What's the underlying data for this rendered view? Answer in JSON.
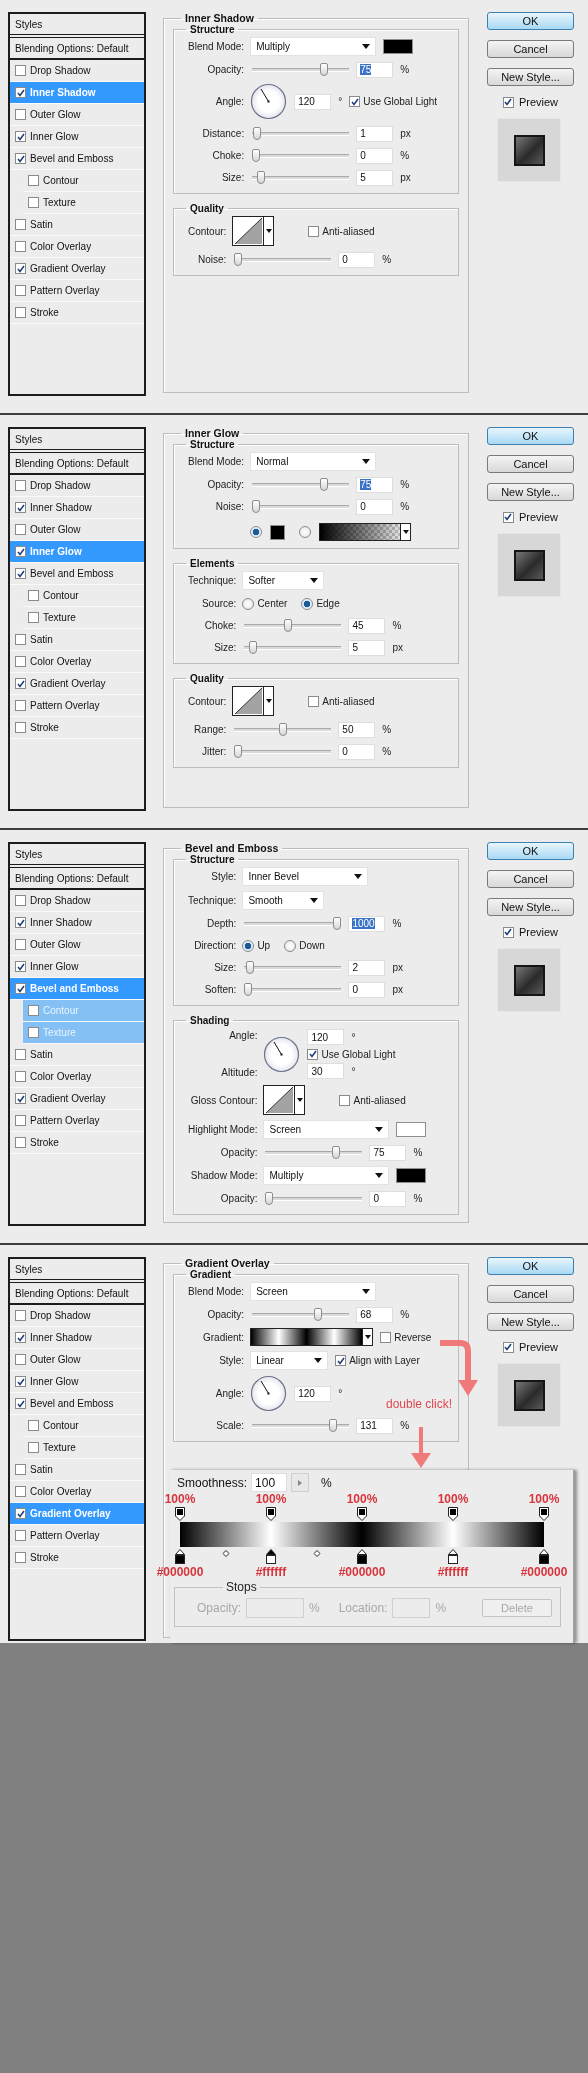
{
  "panels": [
    {
      "styles": {
        "title": "Styles",
        "blending": "Blending Options: Default",
        "items": [
          {
            "label": "Drop Shadow",
            "checked": false,
            "selected": false
          },
          {
            "label": "Inner Shadow",
            "checked": true,
            "selected": true
          },
          {
            "label": "Outer Glow",
            "checked": false,
            "selected": false
          },
          {
            "label": "Inner Glow",
            "checked": true,
            "selected": false
          },
          {
            "label": "Bevel and Emboss",
            "checked": true,
            "selected": false,
            "children": [
              {
                "label": "Contour",
                "checked": false,
                "highlighted": false
              },
              {
                "label": "Texture",
                "checked": false,
                "highlighted": false
              }
            ]
          },
          {
            "label": "Satin",
            "checked": false,
            "selected": false
          },
          {
            "label": "Color Overlay",
            "checked": false,
            "selected": false
          },
          {
            "label": "Gradient Overlay",
            "checked": true,
            "selected": false
          },
          {
            "label": "Pattern Overlay",
            "checked": false,
            "selected": false
          },
          {
            "label": "Stroke",
            "checked": false,
            "selected": false
          }
        ]
      },
      "title": "Inner Shadow",
      "groups": [
        {
          "title": "Structure",
          "rows": [
            {
              "kind": "dropdown",
              "label": "Blend Mode:",
              "value": "Multiply",
              "color": "#000000"
            },
            {
              "kind": "slider",
              "label": "Opacity:",
              "level": 0.76,
              "value": "75",
              "unit": "%",
              "focused": true
            },
            {
              "kind": "angle",
              "label": "Angle:",
              "value": "120",
              "unit": "°",
              "checkbox": {
                "label": "Use Global Light",
                "checked": true
              }
            },
            {
              "kind": "slider",
              "label": "Distance:",
              "level": 0.01,
              "value": "1",
              "unit": "px",
              "focused": false
            },
            {
              "kind": "slider",
              "label": "Choke:",
              "level": 0,
              "value": "0",
              "unit": "%",
              "focused": false
            },
            {
              "kind": "slider",
              "label": "Size:",
              "level": 0.05,
              "value": "5",
              "unit": "px",
              "focused": false
            }
          ]
        },
        {
          "title": "Quality",
          "rows": [
            {
              "kind": "contour",
              "label": "Contour:",
              "checkbox": {
                "label": "Anti-aliased",
                "checked": false
              }
            },
            {
              "kind": "slider",
              "label": "Noise:",
              "level": 0,
              "value": "0",
              "unit": "%",
              "focused": false
            }
          ]
        }
      ],
      "buttons": [
        {
          "label": "OK",
          "default": true
        },
        {
          "label": "Cancel",
          "default": false
        },
        {
          "label": "New Style...",
          "default": false
        }
      ],
      "preview": {
        "label": "Preview",
        "checked": true
      }
    },
    {
      "styles": {
        "title": "Styles",
        "blending": "Blending Options: Default",
        "items": [
          {
            "label": "Drop Shadow",
            "checked": false,
            "selected": false
          },
          {
            "label": "Inner Shadow",
            "checked": true,
            "selected": false
          },
          {
            "label": "Outer Glow",
            "checked": false,
            "selected": false
          },
          {
            "label": "Inner Glow",
            "checked": true,
            "selected": true
          },
          {
            "label": "Bevel and Emboss",
            "checked": true,
            "selected": false,
            "children": [
              {
                "label": "Contour",
                "checked": false,
                "highlighted": false
              },
              {
                "label": "Texture",
                "checked": false,
                "highlighted": false
              }
            ]
          },
          {
            "label": "Satin",
            "checked": false,
            "selected": false
          },
          {
            "label": "Color Overlay",
            "checked": false,
            "selected": false
          },
          {
            "label": "Gradient Overlay",
            "checked": true,
            "selected": false
          },
          {
            "label": "Pattern Overlay",
            "checked": false,
            "selected": false
          },
          {
            "label": "Stroke",
            "checked": false,
            "selected": false
          }
        ]
      },
      "title": "Inner Glow",
      "groups": [
        {
          "title": "Structure",
          "rows": [
            {
              "kind": "dropdown",
              "label": "Blend Mode:",
              "value": "Normal"
            },
            {
              "kind": "slider",
              "label": "Opacity:",
              "level": 0.76,
              "value": "75",
              "unit": "%",
              "focused": true
            },
            {
              "kind": "slider",
              "label": "Noise:",
              "level": 0,
              "value": "0",
              "unit": "%",
              "focused": false
            },
            {
              "kind": "fill_choice",
              "options": [
                {
                  "kind": "color",
                  "selected": true,
                  "color": "#000000"
                },
                {
                  "kind": "gradient",
                  "selected": false
                }
              ]
            }
          ]
        },
        {
          "title": "Elements",
          "rows": [
            {
              "kind": "small_dropdown",
              "label": "Technique:",
              "value": "Softer"
            },
            {
              "kind": "radio",
              "label": "Source:",
              "options": [
                {
                  "label": "Center",
                  "selected": false
                },
                {
                  "label": "Edge",
                  "selected": true
                }
              ]
            },
            {
              "kind": "slider",
              "label": "Choke:",
              "level": 0.45,
              "value": "45",
              "unit": "%",
              "focused": false
            },
            {
              "kind": "slider",
              "label": "Size:",
              "level": 0.05,
              "value": "5",
              "unit": "px",
              "focused": false
            }
          ]
        },
        {
          "title": "Quality",
          "rows": [
            {
              "kind": "contour",
              "label": "Contour:",
              "checkbox": {
                "label": "Anti-aliased",
                "checked": false
              }
            },
            {
              "kind": "slider",
              "label": "Range:",
              "level": 0.5,
              "value": "50",
              "unit": "%",
              "focused": false
            },
            {
              "kind": "slider",
              "label": "Jitter:",
              "level": 0,
              "value": "0",
              "unit": "%",
              "focused": false
            }
          ]
        }
      ],
      "buttons": [
        {
          "label": "OK",
          "default": true
        },
        {
          "label": "Cancel",
          "default": false
        },
        {
          "label": "New Style...",
          "default": false
        }
      ],
      "preview": {
        "label": "Preview",
        "checked": true
      }
    },
    {
      "styles": {
        "title": "Styles",
        "blending": "Blending Options: Default",
        "items": [
          {
            "label": "Drop Shadow",
            "checked": false,
            "selected": false
          },
          {
            "label": "Inner Shadow",
            "checked": true,
            "selected": false
          },
          {
            "label": "Outer Glow",
            "checked": false,
            "selected": false
          },
          {
            "label": "Inner Glow",
            "checked": true,
            "selected": false
          },
          {
            "label": "Bevel and Emboss",
            "checked": true,
            "selected": true,
            "children": [
              {
                "label": "Contour",
                "checked": false,
                "highlighted": true
              },
              {
                "label": "Texture",
                "checked": false,
                "highlighted": true
              }
            ]
          },
          {
            "label": "Satin",
            "checked": false,
            "selected": false
          },
          {
            "label": "Color Overlay",
            "checked": false,
            "selected": false
          },
          {
            "label": "Gradient Overlay",
            "checked": true,
            "selected": false
          },
          {
            "label": "Pattern Overlay",
            "checked": false,
            "selected": false
          },
          {
            "label": "Stroke",
            "checked": false,
            "selected": false
          }
        ]
      },
      "title": "Bevel and Emboss",
      "groups": [
        {
          "title": "Structure",
          "rows": [
            {
              "kind": "dropdown",
              "label": "Style:",
              "value": "Inner Bevel"
            },
            {
              "kind": "small_dropdown",
              "label": "Technique:",
              "value": "Smooth"
            },
            {
              "kind": "slider",
              "label": "Depth:",
              "level": 1,
              "value": "1000",
              "unit": "%",
              "focused": true
            },
            {
              "kind": "radio",
              "label": "Direction:",
              "options": [
                {
                  "label": "Up",
                  "selected": true
                },
                {
                  "label": "Down",
                  "selected": false
                }
              ]
            },
            {
              "kind": "slider",
              "label": "Size:",
              "level": 0.02,
              "value": "2",
              "unit": "px",
              "focused": false
            },
            {
              "kind": "slider",
              "label": "Soften:",
              "level": 0,
              "value": "0",
              "unit": "px",
              "focused": false
            }
          ]
        },
        {
          "title": "Shading",
          "rows": [
            {
              "kind": "shading_angle",
              "label": "Angle:",
              "value": "120",
              "unit": "°",
              "checkbox": {
                "label": "Use Global Light",
                "checked": true
              },
              "altitude_label": "Altitude:",
              "altitude_value": "30",
              "altitude_unit": "°"
            },
            {
              "kind": "contour",
              "label": "Gloss Contour:",
              "checkbox": {
                "label": "Anti-aliased",
                "checked": false
              }
            },
            {
              "kind": "dropdown",
              "label": "Highlight Mode:",
              "value": "Screen",
              "color": "#ffffff"
            },
            {
              "kind": "slider",
              "label": "Opacity:",
              "level": 0.75,
              "value": "75",
              "unit": "%",
              "focused": false
            },
            {
              "kind": "dropdown",
              "label": "Shadow Mode:",
              "value": "Multiply",
              "color": "#000000"
            },
            {
              "kind": "slider",
              "label": "Opacity:",
              "level": 0,
              "value": "0",
              "unit": "%",
              "focused": false
            }
          ]
        }
      ],
      "buttons": [
        {
          "label": "OK",
          "default": true
        },
        {
          "label": "Cancel",
          "default": false
        },
        {
          "label": "New Style...",
          "default": false
        }
      ],
      "preview": {
        "label": "Preview",
        "checked": true
      }
    },
    {
      "styles": {
        "title": "Styles",
        "blending": "Blending Options: Default",
        "items": [
          {
            "label": "Drop Shadow",
            "checked": false,
            "selected": false
          },
          {
            "label": "Inner Shadow",
            "checked": true,
            "selected": false
          },
          {
            "label": "Outer Glow",
            "checked": false,
            "selected": false
          },
          {
            "label": "Inner Glow",
            "checked": true,
            "selected": false
          },
          {
            "label": "Bevel and Emboss",
            "checked": true,
            "selected": false,
            "children": [
              {
                "label": "Contour",
                "checked": false,
                "highlighted": false
              },
              {
                "label": "Texture",
                "checked": false,
                "highlighted": false
              }
            ]
          },
          {
            "label": "Satin",
            "checked": false,
            "selected": false
          },
          {
            "label": "Color Overlay",
            "checked": false,
            "selected": false
          },
          {
            "label": "Gradient Overlay",
            "checked": true,
            "selected": true
          },
          {
            "label": "Pattern Overlay",
            "checked": false,
            "selected": false
          },
          {
            "label": "Stroke",
            "checked": false,
            "selected": false
          }
        ]
      },
      "title": "Gradient Overlay",
      "groups": [
        {
          "title": "Gradient",
          "rows": [
            {
              "kind": "dropdown",
              "label": "Blend Mode:",
              "value": "Screen"
            },
            {
              "kind": "slider",
              "label": "Opacity:",
              "level": 0.69,
              "value": "68",
              "unit": "%",
              "focused": false
            },
            {
              "kind": "gradient",
              "label": "Gradient:",
              "checkbox": {
                "label": "Reverse",
                "checked": false
              }
            },
            {
              "kind": "small_dropdown",
              "label": "Style:",
              "value": "Linear",
              "checkbox": {
                "label": "Align with Layer",
                "checked": true
              }
            },
            {
              "kind": "angle",
              "label": "Angle:",
              "value": "120",
              "unit": "°"
            },
            {
              "kind": "slider",
              "label": "Scale:",
              "level": 0.86,
              "value": "131",
              "unit": "%",
              "focused": false
            }
          ]
        }
      ],
      "buttons": [
        {
          "label": "OK",
          "default": true
        },
        {
          "label": "Cancel",
          "default": false
        },
        {
          "label": "New Style...",
          "default": false
        }
      ],
      "preview": {
        "label": "Preview",
        "checked": true
      },
      "annotation": "double click!",
      "gradient_editor": {
        "smoothness_label": "Smoothness:",
        "smoothness_value": "100",
        "smoothness_unit": "%",
        "stops": [
          {
            "opacity_label": "100%",
            "color_label": "#000000",
            "color": "#000000",
            "selected": false
          },
          {
            "opacity_label": "100%",
            "color_label": "#ffffff",
            "color": "#ffffff",
            "selected": true
          },
          {
            "opacity_label": "100%",
            "color_label": "#000000",
            "color": "#000000",
            "selected": false
          },
          {
            "opacity_label": "100%",
            "color_label": "#ffffff",
            "color": "#ffffff",
            "selected": false
          },
          {
            "opacity_label": "100%",
            "color_label": "#000000",
            "color": "#000000",
            "selected": false
          }
        ],
        "stops_group": {
          "title": "Stops",
          "disabled": true,
          "opacity_label": "Opacity:",
          "opacity_unit": "%",
          "location_label": "Location:",
          "location_unit": "%",
          "delete_label": "Delete"
        }
      }
    }
  ]
}
